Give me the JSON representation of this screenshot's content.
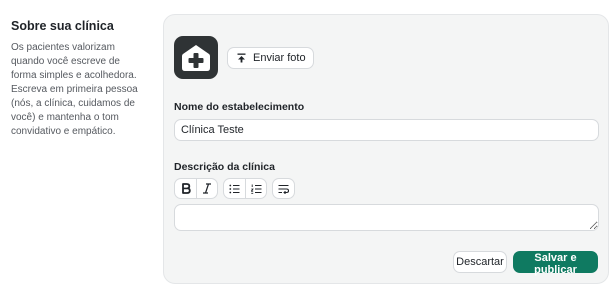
{
  "sidebar": {
    "title": "Sobre sua clínica",
    "description": "Os pacientes valorizam quando você escreve de forma simples e acolhedora. Escreva em primeira pessoa (nós, a clínica, cuidamos de você) e mantenha o tom convidativo e empático."
  },
  "photo": {
    "upload_label": "Enviar foto",
    "logo_icon": "house-plus-icon",
    "upload_icon": "upload-icon"
  },
  "name_field": {
    "label": "Nome do estabelecimento",
    "value": "Clínica Teste"
  },
  "description_field": {
    "label": "Descrição da clínica",
    "value": "",
    "toolbar": [
      "bold-icon",
      "italic-icon",
      "bullet-list-icon",
      "numbered-list-icon",
      "text-wrap-icon"
    ]
  },
  "actions": {
    "discard_label": "Descartar",
    "publish_label": "Salvar e publicar"
  },
  "colors": {
    "primary": "#0f7a61",
    "logo_bg": "#2f3335",
    "card_bg": "#f4f5f5"
  }
}
